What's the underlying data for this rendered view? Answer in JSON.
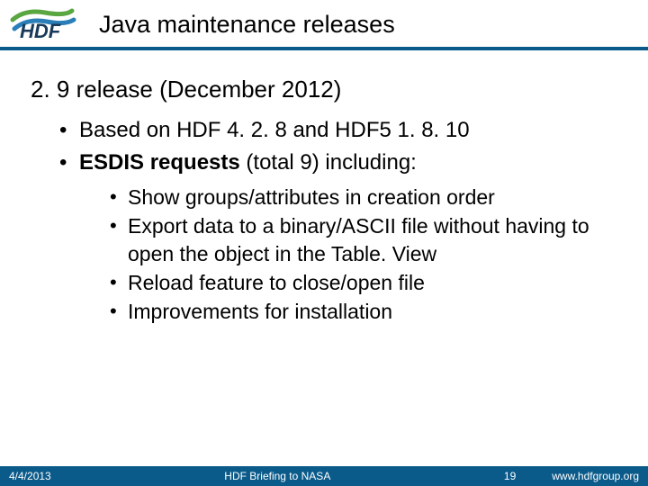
{
  "header": {
    "logo_alt": "HDF",
    "title": "Java maintenance releases"
  },
  "content": {
    "section_heading": "2. 9 release (December 2012)",
    "bullets_lvl1": [
      {
        "text": "Based on HDF 4. 2. 8 and HDF5 1. 8. 10"
      },
      {
        "bold_prefix": "ESDIS requests",
        "rest": " (total 9) including:"
      }
    ],
    "bullets_lvl2": [
      "Show groups/attributes in creation order",
      "Export data to a binary/ASCII file without having to open the object in the Table. View",
      "Reload feature to close/open file",
      "Improvements for installation"
    ]
  },
  "footer": {
    "date": "4/4/2013",
    "center": "HDF Briefing to NASA",
    "page": "19",
    "url": "www.hdfgroup.org"
  },
  "colors": {
    "bar": "#0a5a8a",
    "logo_green": "#5aa641",
    "logo_blue": "#2a7fb8"
  }
}
